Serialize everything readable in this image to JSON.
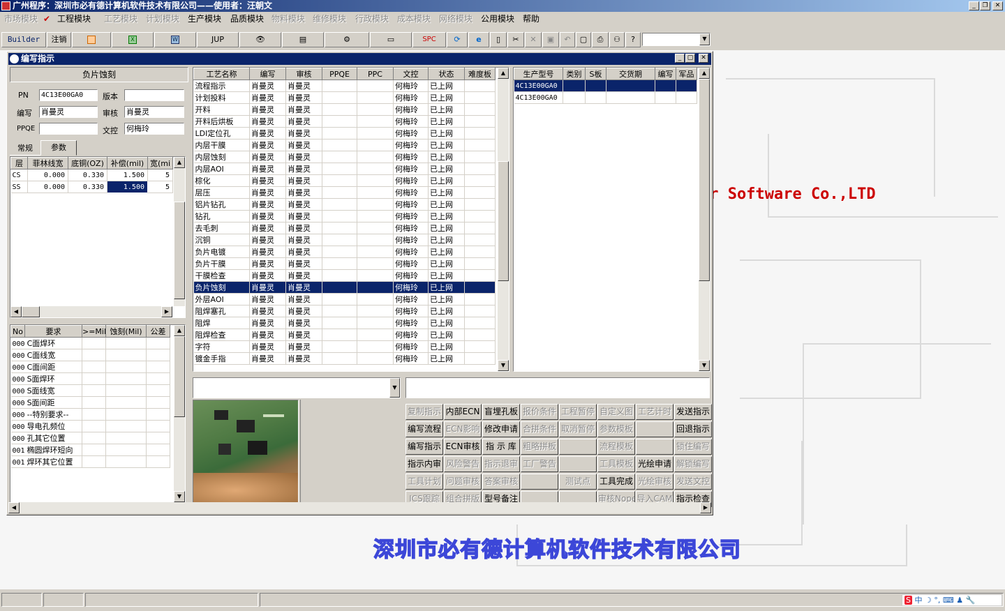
{
  "app": {
    "title": "广州程序：深圳市必有德计算机软件技术有限公司——使用者：汪朝文"
  },
  "menu": [
    {
      "label": "市场模块",
      "enabled": false
    },
    {
      "label": "工程模块",
      "enabled": true,
      "checked": true
    },
    {
      "label": "工艺模块",
      "enabled": false
    },
    {
      "label": "计划模块",
      "enabled": false
    },
    {
      "label": "生产模块",
      "enabled": true
    },
    {
      "label": "品质模块",
      "enabled": true
    },
    {
      "label": "物料模块",
      "enabled": false
    },
    {
      "label": "维修模块",
      "enabled": false
    },
    {
      "label": "行政模块",
      "enabled": false
    },
    {
      "label": "成本模块",
      "enabled": false
    },
    {
      "label": "网络模块",
      "enabled": false
    },
    {
      "label": "公用模块",
      "enabled": true
    },
    {
      "label": "帮助",
      "enabled": true
    }
  ],
  "toolbar": {
    "builder": "Builder",
    "logout": "注销",
    "jup": "JUP",
    "spc": "SPC",
    "icons": [
      "powerpoint-icon",
      "excel-icon",
      "word-icon",
      "eye-icon",
      "database-icon",
      "network-icon",
      "computer-icon",
      "document-refresh-icon",
      "ie-icon",
      "new-document-icon",
      "scissors-icon",
      "close-x-icon",
      "save-icon",
      "undo-icon",
      "preview-icon",
      "print-icon",
      "binoculars-icon",
      "help-icon"
    ]
  },
  "desktop": {
    "brand_text": "er Software Co.,LTD",
    "company_text": "深圳市必有德计算机软件技术有限公司"
  },
  "window": {
    "title": "编写指示",
    "left": {
      "header": "负片蚀刻",
      "pn_label": "PN",
      "pn_value": "4C13E00GA0",
      "version_label": "版本",
      "version_value": "",
      "writer_label": "编写",
      "writer_value": "肖曼灵",
      "review_label": "审核",
      "review_value": "肖曼灵",
      "ppqe_label": "PPQE",
      "ppqe_value": "",
      "doc_label": "文控",
      "doc_value": "何梅玲",
      "tab_general": "常规",
      "tab_params": "参数",
      "param_headers": [
        "层",
        "菲林线宽",
        "底铜(OZ)",
        "补偿(mil)",
        "宽(mi"
      ],
      "param_rows": [
        [
          "CS",
          "0.000",
          "0.330",
          "1.500",
          "5"
        ],
        [
          "SS",
          "0.000",
          "0.330",
          "1.500",
          "5"
        ]
      ],
      "req_headers": [
        "No",
        "要求",
        ">=Mil",
        "蚀刻(Mil)",
        "公差"
      ],
      "req_rows": [
        [
          "000",
          "C面焊环"
        ],
        [
          "000",
          "C面线宽"
        ],
        [
          "000",
          "C面间距"
        ],
        [
          "000",
          "S面焊环"
        ],
        [
          "000",
          "S面线宽"
        ],
        [
          "000",
          "S面间距"
        ],
        [
          "000",
          "--特别要求--"
        ],
        [
          "000",
          "导电孔频位"
        ],
        [
          "000",
          "孔其它位置"
        ],
        [
          "001",
          "椭圆焊环短向"
        ],
        [
          "001",
          "焊环其它位置"
        ]
      ]
    },
    "process": {
      "headers": [
        "工艺名称",
        "编写",
        "审核",
        "PPQE",
        "PPC",
        "文控",
        "状态",
        "难度板"
      ],
      "writer": "肖曼灵",
      "reviewer": "肖曼灵",
      "doc": "何梅玲",
      "status": "已上网",
      "rows": [
        "流程指示",
        "计划投料",
        "开料",
        "开料后烘板",
        "LDI定位孔",
        "内层干膜",
        "内层蚀刻",
        "内层AOI",
        "棕化",
        "层压",
        "铝片钻孔",
        "钻孔",
        "去毛刺",
        "沉铜",
        "负片电镀",
        "负片干膜",
        "干膜检查",
        "负片蚀刻",
        "外层AOI",
        "阻焊塞孔",
        "阻焊",
        "阻焊检查",
        "字符",
        "镀金手指"
      ],
      "selected_index": 17
    },
    "models": {
      "headers": [
        "生产型号",
        "类别",
        "S板",
        "交货期",
        "编写",
        "军品"
      ],
      "rows": [
        "4C13E00GA0",
        "4C13E00GA0"
      ]
    },
    "buttons": [
      [
        {
          "l": "复制指示",
          "e": false
        },
        {
          "l": "内部ECN",
          "e": true
        },
        {
          "l": "盲埋孔板",
          "e": true
        },
        {
          "l": "报价条件",
          "e": false
        },
        {
          "l": "工程暂停",
          "e": false
        },
        {
          "l": "自定义图",
          "e": false
        },
        {
          "l": "工艺计时",
          "e": false
        },
        {
          "l": "发送指示",
          "e": true
        }
      ],
      [
        {
          "l": "编写流程",
          "e": true
        },
        {
          "l": "ECN影响",
          "e": false
        },
        {
          "l": "修改申请",
          "e": true
        },
        {
          "l": "合拼条件",
          "e": false
        },
        {
          "l": "取消暂停",
          "e": false
        },
        {
          "l": "参数模板",
          "e": false
        },
        {
          "l": "",
          "e": false
        },
        {
          "l": "回退指示",
          "e": true
        }
      ],
      [
        {
          "l": "编写指示",
          "e": true
        },
        {
          "l": "ECN审核",
          "e": true
        },
        {
          "l": "指 示 库",
          "e": true
        },
        {
          "l": "粗略拼板",
          "e": false
        },
        {
          "l": "",
          "e": false
        },
        {
          "l": "流程模板",
          "e": false
        },
        {
          "l": "",
          "e": false
        },
        {
          "l": "锁住编写",
          "e": false
        }
      ],
      [
        {
          "l": "指示内审",
          "e": true
        },
        {
          "l": "风险警告",
          "e": false
        },
        {
          "l": "指示退审",
          "e": false
        },
        {
          "l": "工厂警告",
          "e": false
        },
        {
          "l": "",
          "e": false
        },
        {
          "l": "工具模板",
          "e": false
        },
        {
          "l": "光绘申请",
          "e": true
        },
        {
          "l": "解锁编写",
          "e": false
        }
      ],
      [
        {
          "l": "工具计划",
          "e": false
        },
        {
          "l": "问题审核",
          "e": false
        },
        {
          "l": "答案审核",
          "e": false
        },
        {
          "l": "",
          "e": false
        },
        {
          "l": "测试点",
          "e": false
        },
        {
          "l": "工具完成",
          "e": true
        },
        {
          "l": "光绘审核",
          "e": false
        },
        {
          "l": "发送文控",
          "e": false
        }
      ],
      [
        {
          "l": "ICS跟踪",
          "e": false
        },
        {
          "l": "组合拼版",
          "e": false
        },
        {
          "l": "型号备注",
          "e": true
        },
        {
          "l": "",
          "e": false
        },
        {
          "l": "",
          "e": false
        },
        {
          "l": "审核Nope",
          "e": false
        },
        {
          "l": "导入CAM",
          "e": false
        },
        {
          "l": "指示检查",
          "e": true
        }
      ]
    ]
  },
  "colors": {
    "selection": "#0a246a",
    "titlebar": "#0a246a",
    "brand": "#cc0000",
    "company_outline": "#3c47d8"
  }
}
